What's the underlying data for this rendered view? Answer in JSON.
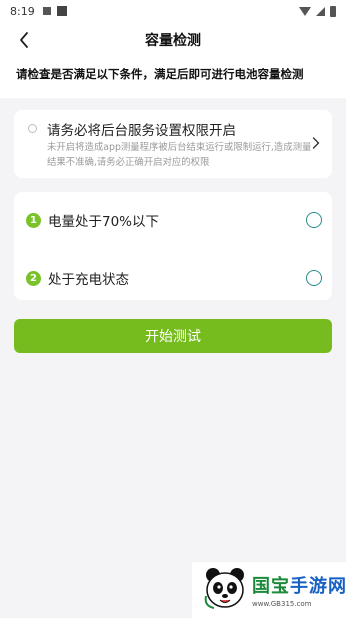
{
  "status_bar": {
    "time": "8:19"
  },
  "header": {
    "title": "容量检测"
  },
  "notice": {
    "text": "请检查是否满足以下条件，满足后即可进行电池容量检测"
  },
  "permission": {
    "title": "请务必将后台服务设置权限开启",
    "desc": "未开启将造成app测量程序被后台结束运行或限制运行,造成测量结果不准确,请务必正确开启对应的权限"
  },
  "conditions": [
    {
      "number": "1",
      "label": "电量处于70%以下"
    },
    {
      "number": "2",
      "label": "处于充电状态"
    }
  ],
  "start_button": {
    "label": "开始测试"
  },
  "watermark": {
    "title_a": "国宝",
    "title_b": "手游网",
    "url": "www.GB315.com"
  },
  "colors": {
    "accent": "#77bc1f",
    "badge": "#7ac229",
    "check": "#2a8a8a"
  }
}
